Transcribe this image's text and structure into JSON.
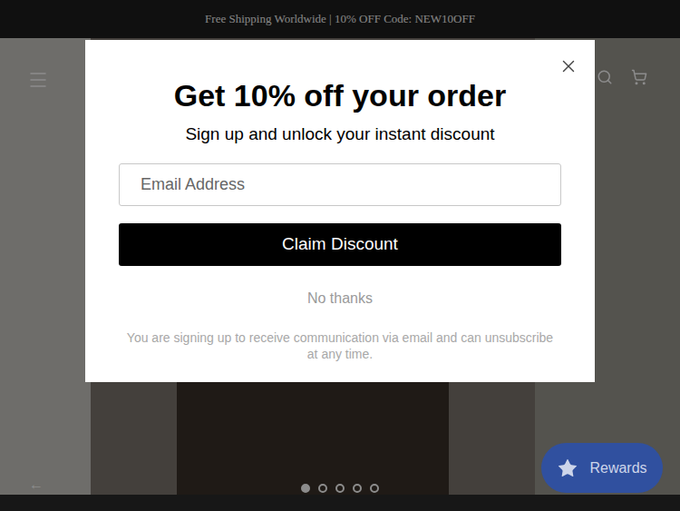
{
  "announcement": "Free Shipping Worldwide | 10% OFF Code: NEW10OFF",
  "slider": {
    "arrow": "←",
    "dots": [
      {
        "selected": true
      },
      {
        "selected": false
      },
      {
        "selected": false
      },
      {
        "selected": false
      },
      {
        "selected": false
      }
    ]
  },
  "popup": {
    "title": "Get 10% off your order",
    "subtitle": "Sign up and unlock your instant discount",
    "email_placeholder": "Email Address",
    "button": "Claim Discount",
    "decline": "No thanks",
    "disclaimer": "You are signing up to receive communication via email and can unsubscribe at any time."
  },
  "rewards_button": {
    "label": "Rewards"
  }
}
